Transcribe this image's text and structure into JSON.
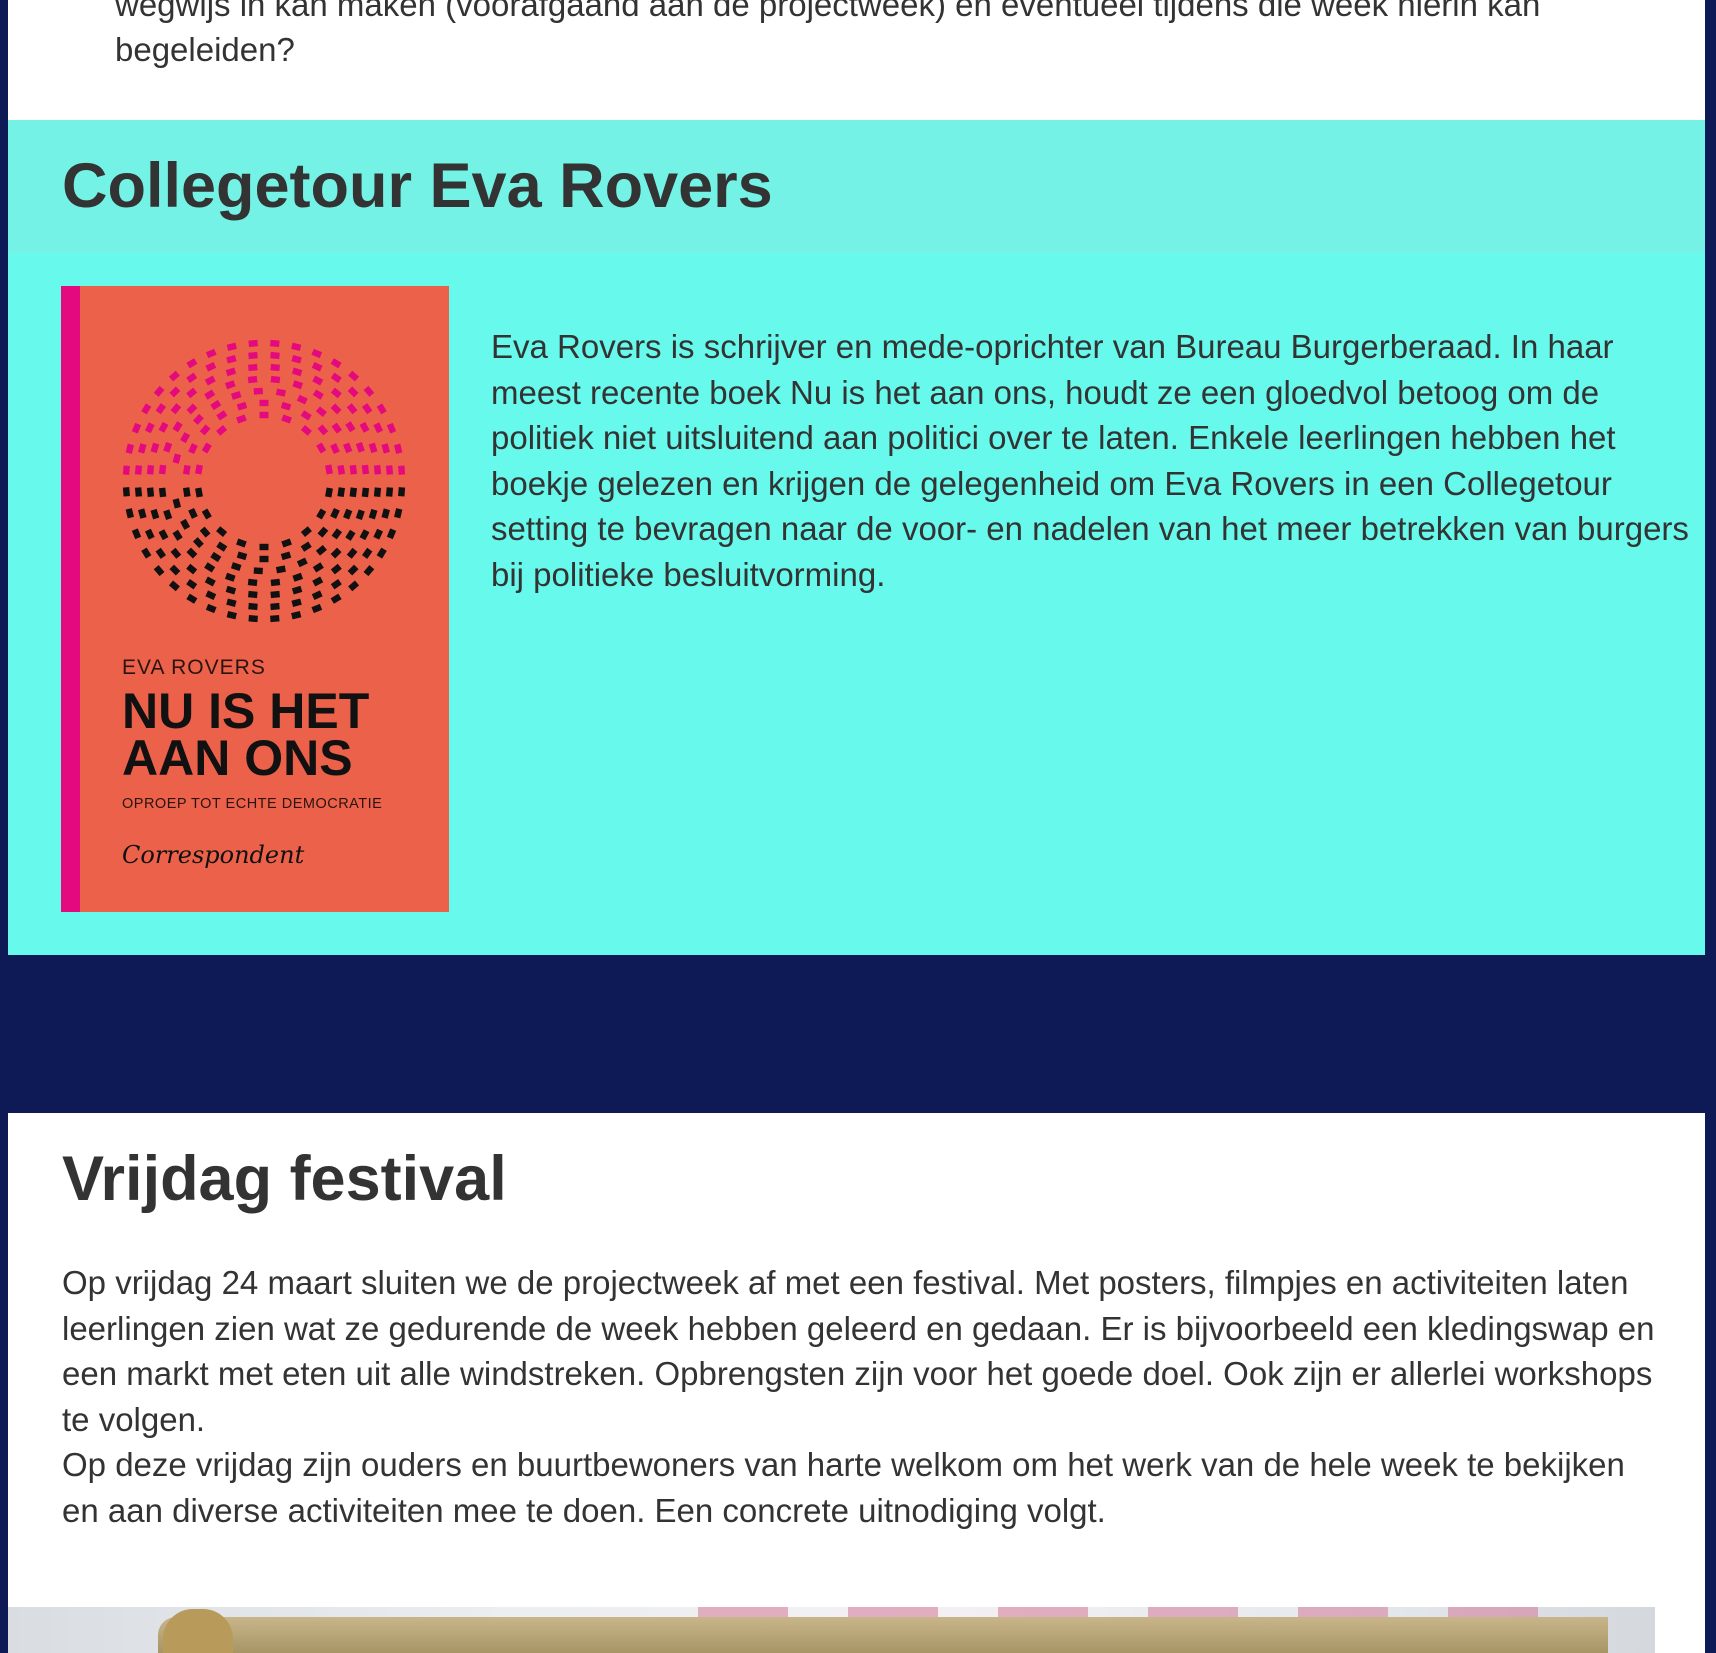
{
  "intro": {
    "text": "wegwijs in kan maken (voorafgaand aan de projectweek) en eventueel tijdens die week hierin kan begeleiden?"
  },
  "eva": {
    "title": "Collegetour Eva Rovers",
    "description": "Eva Rovers is schrijver en mede-oprichter van Bureau Burgerberaad. In haar meest recente boek Nu is het aan ons, houdt ze een gloedvol betoog om de politiek niet uitsluitend aan politici over te laten. Enkele leerlingen hebben het boekje gelezen en krijgen de gelegenheid om Eva Rovers in een Collegetour setting te bevragen naar de voor- en nadelen van het meer betrekken van burgers bij politieke besluitvorming.",
    "book": {
      "author": "EVA ROVERS",
      "title_line1": "NU IS HET",
      "title_line2": "AAN ONS",
      "subtitle": "OPROEP TOT ECHTE DEMOCRATIE",
      "publisher": "Correspondent",
      "colors": {
        "cover": "#ec6149",
        "spine": "#e4097f",
        "seats_top": "#e4097f",
        "seats_bottom": "#111111"
      }
    }
  },
  "vrijdag": {
    "title": "Vrijdag festival",
    "paragraph1": "Op vrijdag 24 maart sluiten we de projectweek af met een festival. Met posters, filmpjes en activiteiten laten leerlingen zien wat ze gedurende de week hebben geleerd en gedaan. Er is bijvoorbeeld een kledingswap en een markt met eten uit alle windstreken. Opbrengsten zijn voor het goede doel. Ook zijn er allerlei workshops te volgen.",
    "paragraph2": "Op deze vrijdag zijn ouders en buurtbewoners van harte welkom om het werk van de hele week te bekijken en aan diverse activiteiten mee te doen. Een concrete uitnodiging volgt."
  },
  "colors": {
    "background": "#0d1a56",
    "eva_header": "#74f2e6",
    "eva_body": "#66f9ec",
    "text": "#333333"
  }
}
